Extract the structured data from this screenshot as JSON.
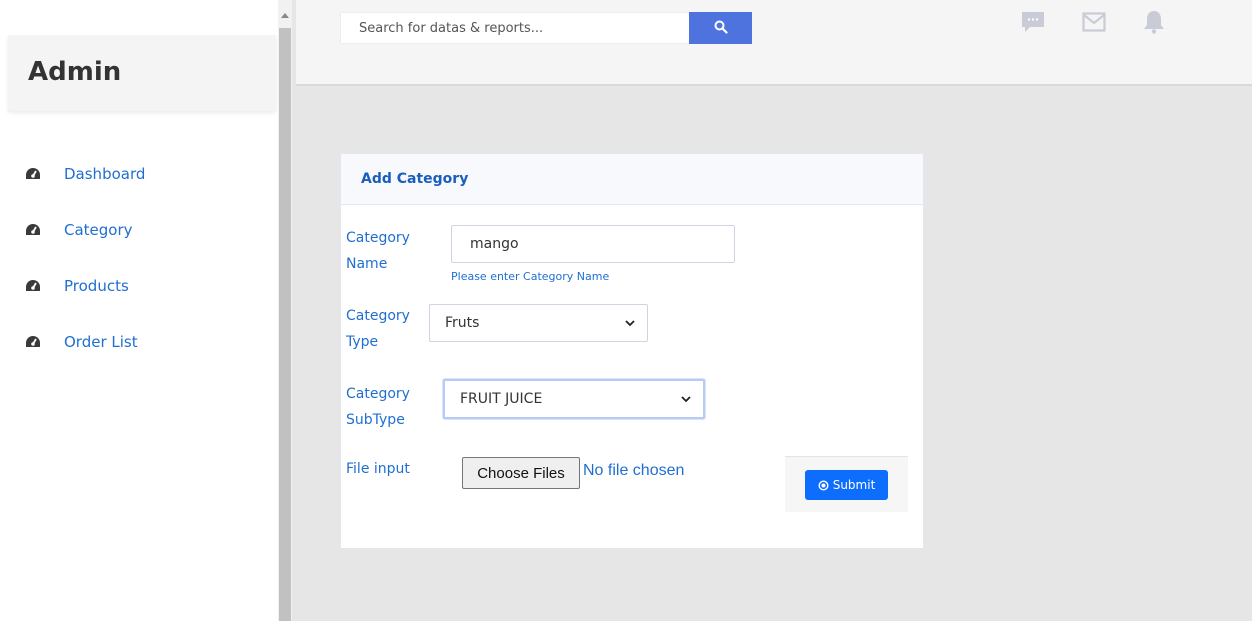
{
  "sidebar": {
    "brand": "Admin",
    "items": [
      {
        "label": "Dashboard",
        "icon": "tachometer-icon"
      },
      {
        "label": "Category",
        "icon": "tachometer-icon"
      },
      {
        "label": "Products",
        "icon": "tachometer-icon"
      },
      {
        "label": "Order List",
        "icon": "tachometer-icon"
      }
    ]
  },
  "topbar": {
    "search_placeholder": "Search for datas & reports...",
    "icons": [
      "message-icon",
      "mail-icon",
      "bell-icon"
    ]
  },
  "form": {
    "title": "Add Category",
    "category_name_label_1": "Category",
    "category_name_label_2": "Name",
    "category_name_value": "mango",
    "category_name_help": "Please enter Category Name",
    "category_type_label_1": "Category",
    "category_type_label_2": "Type",
    "category_type_value": "Fruts",
    "category_subtype_label_1": "Category",
    "category_subtype_label_2": "SubType",
    "category_subtype_value": "FRUIT JUICE",
    "file_label": "File input",
    "file_button": "Choose Files",
    "file_status": "No file chosen",
    "submit_label": "Submit"
  },
  "colors": {
    "accent": "#1f6fd1",
    "search_button": "#4e73df",
    "submit_button": "#0d6efd"
  }
}
